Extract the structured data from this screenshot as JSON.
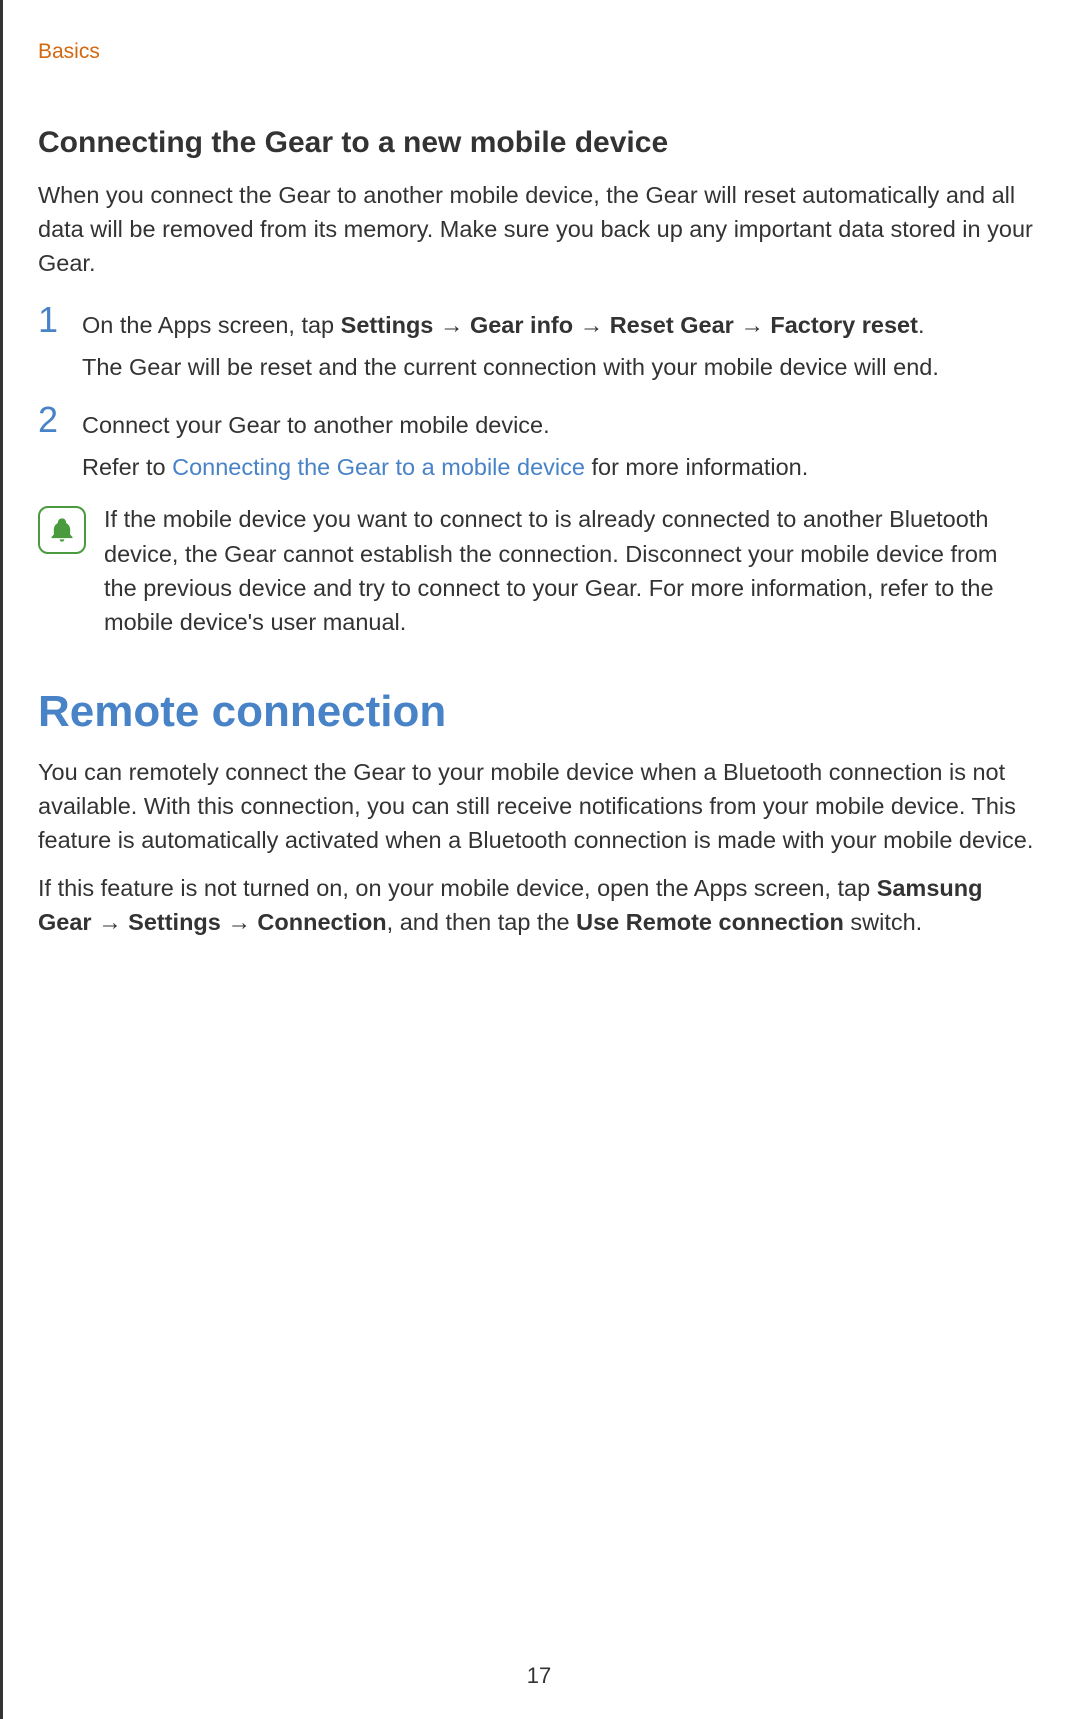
{
  "header": {
    "breadcrumb": "Basics"
  },
  "section1": {
    "title": "Connecting the Gear to a new mobile device",
    "intro": "When you connect the Gear to another mobile device, the Gear will reset automatically and all data will be removed from its memory. Make sure you back up any important data stored in your Gear.",
    "step1": {
      "num": "1",
      "line1_pre": "On the Apps screen, tap ",
      "settings": "Settings",
      "arrow1": " → ",
      "gearinfo": "Gear info",
      "arrow2": " → ",
      "resetgear": "Reset Gear",
      "arrow3": " → ",
      "factory": "Factory reset",
      "period": ".",
      "line2": "The Gear will be reset and the current connection with your mobile device will end."
    },
    "step2": {
      "num": "2",
      "line1": "Connect your Gear to another mobile device.",
      "line2_pre": "Refer to ",
      "link": "Connecting the Gear to a mobile device",
      "line2_post": " for more information."
    },
    "note": "If the mobile device you want to connect to is already connected to another Bluetooth device, the Gear cannot establish the connection. Disconnect your mobile device from the previous device and try to connect to your Gear. For more information, refer to the mobile device's user manual."
  },
  "section2": {
    "title": "Remote connection",
    "para1": "You can remotely connect the Gear to your mobile device when a Bluetooth connection is not available. With this connection, you can still receive notifications from your mobile device. This feature is automatically activated when a Bluetooth connection is made with your mobile device.",
    "para2_pre": "If this feature is not turned on, on your mobile device, open the Apps screen, tap ",
    "samsung": "Samsung Gear",
    "arrow1": " → ",
    "settings": "Settings",
    "arrow2": " → ",
    "connection": "Connection",
    "mid": ", and then tap the ",
    "remote": "Use Remote connection",
    "post": " switch."
  },
  "footer": {
    "page_number": "17"
  }
}
